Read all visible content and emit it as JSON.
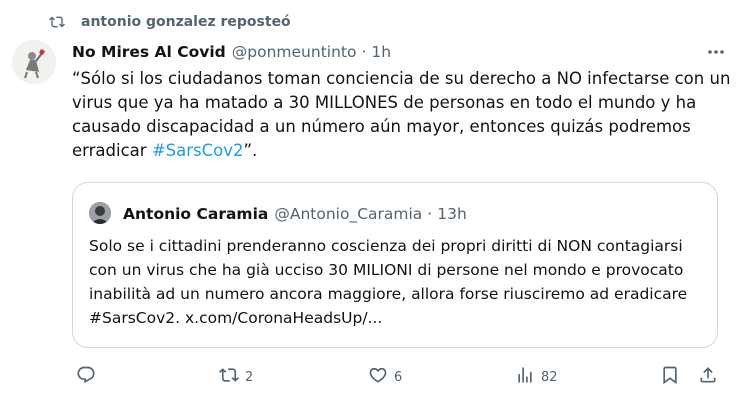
{
  "repost": {
    "icon": "repost-icon",
    "text": "antonio gonzalez reposteó"
  },
  "tweet": {
    "avatar": "avatar",
    "name": "No Mires Al Covid",
    "handle": "@ponmeuntinto",
    "separator": "·",
    "time": "1h",
    "text_main": "“Sólo si los ciudadanos toman conciencia de su derecho a NO infectarse con un virus que ya ha matado a 30 MILLONES de personas en todo el mundo y ha causado discapacidad a un número aún mayor, entonces quizás podremos erradicar ",
    "hashtag": "#SarsCov2",
    "text_end": "”.",
    "more_icon": "more-icon"
  },
  "quote": {
    "name": "Antonio Caramia",
    "handle": "@Antonio_Caramia",
    "separator": "·",
    "time": "13h",
    "text": "Solo se i cittadini prenderanno coscienza dei propri diritti di NON contagiarsi con un virus che ha già ucciso 30 MILIONI di persone nel mondo e provocato inabilità ad un numero ancora maggiore, allora forse riusciremo ad eradicare #SarsCov2. x.com/CoronaHeadsUp/..."
  },
  "actions": {
    "reply": {
      "icon": "reply-icon",
      "count": ""
    },
    "repost": {
      "icon": "repost-icon",
      "count": "2"
    },
    "like": {
      "icon": "heart-icon",
      "count": "6"
    },
    "views": {
      "icon": "views-icon",
      "count": "82"
    },
    "bookmark": {
      "icon": "bookmark-icon"
    },
    "share": {
      "icon": "share-icon"
    }
  },
  "colors": {
    "text": "#0f1419",
    "secondary": "#536471",
    "link": "#1d9bf0",
    "border": "#cfd9de",
    "repost_active": "#536471"
  }
}
